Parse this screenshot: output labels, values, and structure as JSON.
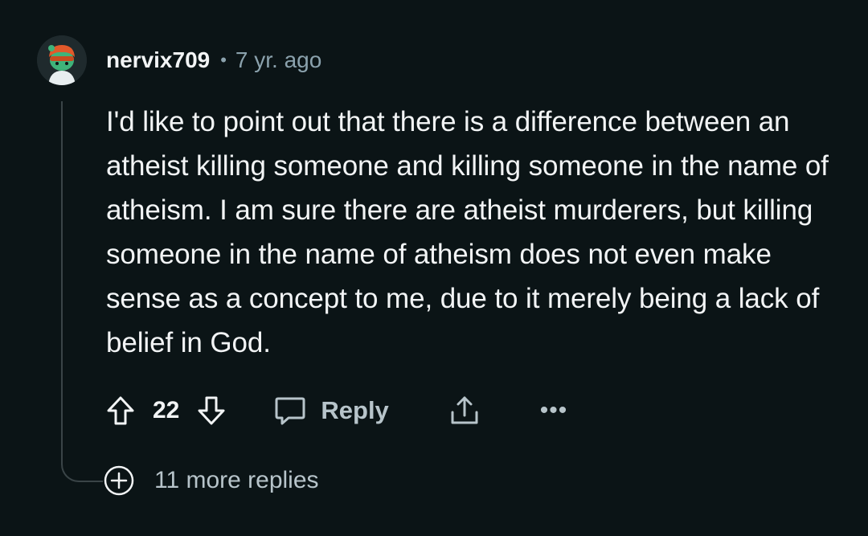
{
  "comment": {
    "username": "nervix709",
    "separator": "•",
    "timestamp": "7 yr. ago",
    "body": "I'd like to point out that there is a difference between an atheist killing someone and killing someone in the name of atheism. I am sure there are atheist murderers, but killing someone in the name of atheism does not even make sense as a concept to me, due to it merely being a lack of belief in God."
  },
  "actions": {
    "vote_count": "22",
    "reply_label": "Reply",
    "more_label": "•••"
  },
  "thread": {
    "more_replies_label": "11 more replies"
  },
  "icons": {
    "avatar": "avatar-icon",
    "upvote": "upvote-arrow-icon",
    "downvote": "downvote-arrow-icon",
    "reply": "speech-bubble-icon",
    "share": "share-icon",
    "more": "ellipsis-icon",
    "expand": "plus-circle-icon"
  },
  "colors": {
    "background": "#0b1416",
    "text_primary": "#f2f4f5",
    "text_secondary": "#8ba2ad",
    "action_text": "#b7c4ca",
    "thread_line": "#3a4447"
  }
}
